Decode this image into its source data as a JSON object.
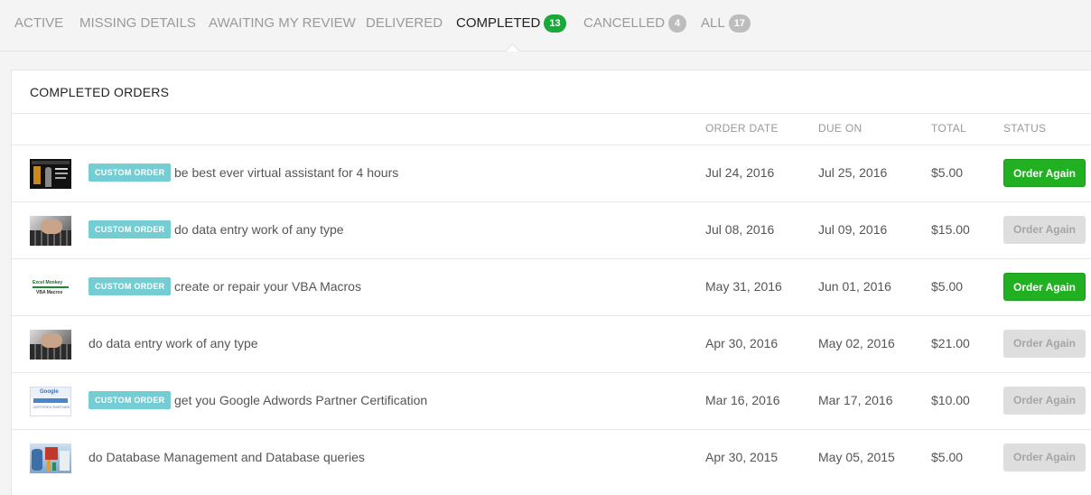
{
  "tabs": [
    {
      "label": "ACTIVE",
      "badge": ""
    },
    {
      "label": "MISSING DETAILS",
      "badge": ""
    },
    {
      "label": "AWAITING MY REVIEW",
      "badge": ""
    },
    {
      "label": "DELIVERED",
      "badge": ""
    },
    {
      "label": "COMPLETED",
      "badge": "13"
    },
    {
      "label": "CANCELLED",
      "badge": "4"
    },
    {
      "label": "ALL",
      "badge": "17"
    }
  ],
  "panel": {
    "title": "COMPLETED ORDERS",
    "columns": {
      "order_date": "ORDER DATE",
      "due_on": "DUE ON",
      "total": "TOTAL",
      "status": "STATUS"
    }
  },
  "orders": [
    {
      "tag": "CUSTOM ORDER",
      "title": "be best ever virtual assistant for 4 hours",
      "order_date": "Jul 24, 2016",
      "due_on": "Jul 25, 2016",
      "total": "$5.00",
      "button": "Order Again",
      "button_enabled": true,
      "thumb": "virtual-assistant-thumbnail"
    },
    {
      "tag": "CUSTOM ORDER",
      "title": "do data entry work of any type",
      "order_date": "Jul 08, 2016",
      "due_on": "Jul 09, 2016",
      "total": "$15.00",
      "button": "Order Again",
      "button_enabled": false,
      "thumb": "keyboard-typing-thumbnail"
    },
    {
      "tag": "CUSTOM ORDER",
      "title": "create or repair your VBA Macros",
      "order_date": "May 31, 2016",
      "due_on": "Jun 01, 2016",
      "total": "$5.00",
      "button": "Order Again",
      "button_enabled": true,
      "thumb": "excel-monkey-logo"
    },
    {
      "tag": "",
      "title": "do data entry work of any type",
      "order_date": "Apr 30, 2016",
      "due_on": "May 02, 2016",
      "total": "$21.00",
      "button": "Order Again",
      "button_enabled": false,
      "thumb": "keyboard-typing-thumbnail"
    },
    {
      "tag": "CUSTOM ORDER",
      "title": "get you Google Adwords Partner Certification",
      "order_date": "Mar 16, 2016",
      "due_on": "Mar 17, 2016",
      "total": "$10.00",
      "button": "Order Again",
      "button_enabled": false,
      "thumb": "google-partner-badge"
    },
    {
      "tag": "",
      "title": "do Database Management and Database queries",
      "order_date": "Apr 30, 2015",
      "due_on": "May 05, 2015",
      "total": "$5.00",
      "button": "Order Again",
      "button_enabled": false,
      "thumb": "database-charts-thumbnail"
    }
  ],
  "thumb_text": {
    "excel_top": "Excel Monkey",
    "excel_bottom": "VBA Macros",
    "google_word": "Google",
    "google_sub": "CERTIFIED PARTNER"
  },
  "colors": {
    "accent_green": "#21b021",
    "tag_teal": "#73cdd3",
    "disabled": "#dedede"
  }
}
